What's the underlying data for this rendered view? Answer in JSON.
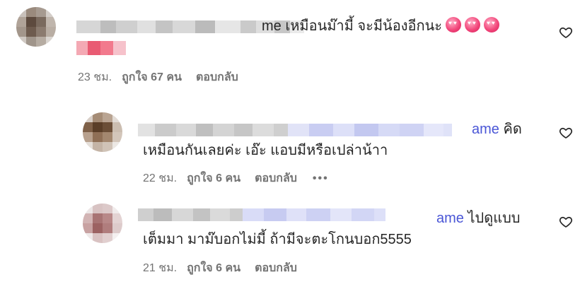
{
  "comments": [
    {
      "handle_tail": "me",
      "text": "เหมือนม๊ามี้ จะมีน้องอีกนะ",
      "emoji": [
        "heart-eyes-emoji",
        "heart-eyes-emoji",
        "heart-eyes-emoji"
      ],
      "time": "23 ชม.",
      "likes": "ถูกใจ 67 คน",
      "reply": "ตอบกลับ"
    },
    {
      "mention_tail": "ame",
      "line1_text": "คิด",
      "line2_text": "เหมือนกันเลยค่ะ เอ๊ะ แอบมีหรือเปล่าน้าา",
      "time": "22 ชม.",
      "likes": "ถูกใจ 6 คน",
      "reply": "ตอบกลับ",
      "more": "•••"
    },
    {
      "mention_tail": "ame",
      "line1_text": "ไปดูแบบ",
      "line2_text": "เต็มมา มาม๊บอกไม่มี้ ถ้ามีจะตะโกนบอก5555",
      "time": "21 ชม.",
      "likes": "ถูกใจ 6 คน",
      "reply": "ตอบกลับ"
    }
  ],
  "colors": {
    "text": "#262626",
    "meta": "#737373",
    "mention": "#4a56d6"
  }
}
